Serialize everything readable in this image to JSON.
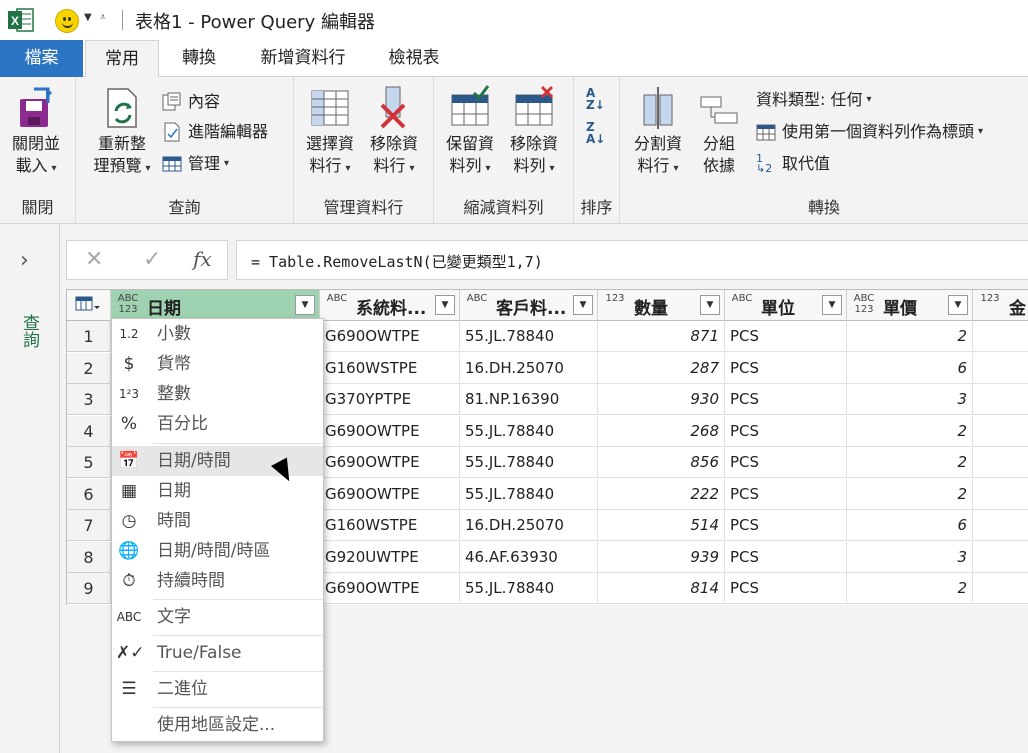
{
  "window": {
    "title": "表格1 - Power Query 編輯器"
  },
  "tabs": [
    "檔案",
    "常用",
    "轉換",
    "新增資料行",
    "檢視表"
  ],
  "ribbon": {
    "close": {
      "label1": "關閉並",
      "label2": "載入",
      "group": "關閉"
    },
    "query": {
      "refresh1": "重新整",
      "refresh2": "理預覽",
      "properties": "內容",
      "advanced": "進階編輯器",
      "manage": "管理",
      "group": "查詢"
    },
    "columns": {
      "choose1": "選擇資",
      "choose2": "料行",
      "remove1": "移除資",
      "remove2": "料行",
      "group": "管理資料行"
    },
    "rows": {
      "keep1": "保留資",
      "keep2": "料列",
      "remove1": "移除資",
      "remove2": "料列",
      "group": "縮減資料列"
    },
    "sort": {
      "group": "排序"
    },
    "transform": {
      "split1": "分割資",
      "split2": "料行",
      "group1": "分組",
      "group2": "依據",
      "datatype": "資料類型: 任何",
      "first_row": "使用第一個資料列作為標頭",
      "replace": "取代值",
      "group": "轉換"
    }
  },
  "nav": {
    "label": "查詢"
  },
  "formula": {
    "x": "✕",
    "check": "✓",
    "fx": "fx",
    "text": "= Table.RemoveLastN(已變更類型1,7)"
  },
  "columns": [
    {
      "type": "ABC\n123",
      "name": "日期"
    },
    {
      "type": "ABC",
      "name": "系統料..."
    },
    {
      "type": "ABC",
      "name": "客戶料..."
    },
    {
      "type": "123",
      "name": "數量"
    },
    {
      "type": "ABC",
      "name": "單位"
    },
    {
      "type": "ABC\n123",
      "name": "單價"
    },
    {
      "type": "123",
      "name": "金"
    }
  ],
  "rows": [
    {
      "n": "1",
      "sys": "G690OWTPE",
      "cust": "55.JL.78840",
      "qty": "871",
      "unit": "PCS",
      "price": "2"
    },
    {
      "n": "2",
      "sys": "G160WSTPE",
      "cust": "16.DH.25070",
      "qty": "287",
      "unit": "PCS",
      "price": "6"
    },
    {
      "n": "3",
      "sys": "G370YPTPE",
      "cust": "81.NP.16390",
      "qty": "930",
      "unit": "PCS",
      "price": "3"
    },
    {
      "n": "4",
      "sys": "G690OWTPE",
      "cust": "55.JL.78840",
      "qty": "268",
      "unit": "PCS",
      "price": "2"
    },
    {
      "n": "5",
      "sys": "G690OWTPE",
      "cust": "55.JL.78840",
      "qty": "856",
      "unit": "PCS",
      "price": "2"
    },
    {
      "n": "6",
      "sys": "G690OWTPE",
      "cust": "55.JL.78840",
      "qty": "222",
      "unit": "PCS",
      "price": "2"
    },
    {
      "n": "7",
      "sys": "G160WSTPE",
      "cust": "16.DH.25070",
      "qty": "514",
      "unit": "PCS",
      "price": "6"
    },
    {
      "n": "8",
      "sys": "G920UWTPE",
      "cust": "46.AF.63930",
      "qty": "939",
      "unit": "PCS",
      "price": "3"
    },
    {
      "n": "9",
      "sys": "G690OWTPE",
      "cust": "55.JL.78840",
      "qty": "814",
      "unit": "PCS",
      "price": "2"
    }
  ],
  "menu": [
    {
      "icon": "1.2",
      "label": "小數"
    },
    {
      "icon": "$",
      "label": "貨幣"
    },
    {
      "icon": "1²3",
      "label": "整數"
    },
    {
      "icon": "%",
      "label": "百分比"
    },
    {
      "icon": "📅",
      "label": "日期/時間"
    },
    {
      "icon": "▦",
      "label": "日期"
    },
    {
      "icon": "◷",
      "label": "時間"
    },
    {
      "icon": "🌐",
      "label": "日期/時間/時區"
    },
    {
      "icon": "⏱",
      "label": "持續時間"
    },
    {
      "icon": "ABC",
      "label": "文字"
    },
    {
      "icon": "✗✓",
      "label": "True/False"
    },
    {
      "icon": "☰",
      "label": "二進位"
    },
    {
      "icon": "",
      "label": "使用地區設定..."
    }
  ]
}
